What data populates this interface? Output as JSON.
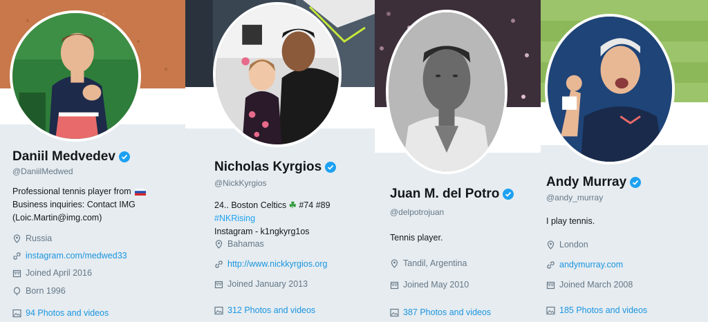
{
  "profiles": [
    {
      "name": "Daniil Medvedev",
      "handle": "@DaniilMedwed",
      "bio_line1": "Professional tennis player from",
      "bio_line2": "Business inquiries: Contact IMG",
      "bio_line3": "(Loic.Martin@img.com)",
      "location": "Russia",
      "website": "instagram.com/medwed33",
      "joined": "Joined April 2016",
      "born": "Born 1996",
      "photos": "94 Photos and videos",
      "banner_color": "#c8784a"
    },
    {
      "name": "Nicholas Kyrgios",
      "handle": "@NickKyrgios",
      "bio_line1_a": "24.. Boston Celtics",
      "bio_clover": "☘",
      "bio_line1_b": "#74 #89",
      "bio_hashtag": "#NKRising",
      "bio_line2": "Instagram - k1ngkyrg1os",
      "location": "Bahamas",
      "website": "http://www.nickkyrgios.org",
      "joined": "Joined January 2013",
      "photos": "312 Photos and videos",
      "banner_color": "#3a4552"
    },
    {
      "name": "Juan M. del Potro",
      "handle": "@delpotrojuan",
      "bio_line1": "Tennis player.",
      "location": "Tandil, Argentina",
      "joined": "Joined May 2010",
      "photos": "387 Photos and videos",
      "banner_color": "#3c2f3a"
    },
    {
      "name": "Andy Murray",
      "handle": "@andy_murray",
      "bio_line1": "I play tennis.",
      "location": "London",
      "website": "andymurray.com",
      "joined": "Joined March 2008",
      "photos": "185 Photos and videos",
      "banner_color": "#8cb85a"
    }
  ],
  "colors": {
    "link": "#1b95e0",
    "verified": "#1da1f2",
    "muted": "#657786",
    "card_bg": "#e6ecf0"
  }
}
